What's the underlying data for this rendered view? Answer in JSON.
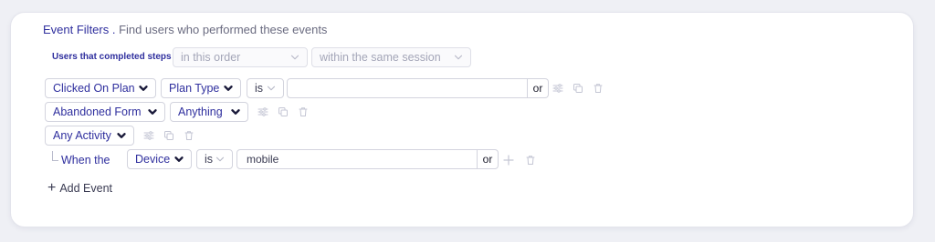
{
  "header": {
    "title": "Event Filters .",
    "subtitle": "Find users who performed these events"
  },
  "steps": {
    "label": "Users that completed steps",
    "order_value": "in this order",
    "session_value": "within the same session"
  },
  "rows": [
    {
      "event": "Clicked On Plan",
      "property": "Plan Type",
      "operator": "is",
      "value": "",
      "or_label": "or"
    },
    {
      "event": "Abandoned Form",
      "property": "Anything"
    },
    {
      "event": "Any Activity"
    }
  ],
  "sub_filter": {
    "prefix": "When the",
    "property": "Device",
    "operator": "is",
    "value": "mobile",
    "or_label": "or"
  },
  "add_event_label": "Add Event",
  "icons": [
    "filter-icon",
    "copy-icon",
    "trash-icon",
    "plus-icon",
    "chevron-down-icon"
  ],
  "colors": {
    "accent": "#2f2f9e",
    "background": "#eff0f5",
    "card": "#ffffff",
    "muted_icon": "#c4c6d4"
  }
}
